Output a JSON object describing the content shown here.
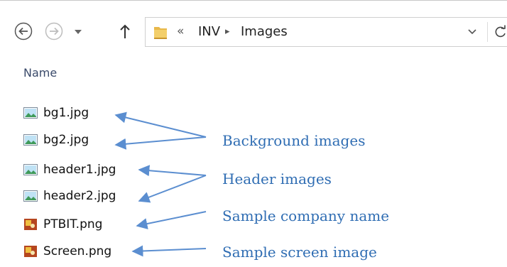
{
  "toolbar": {
    "back_icon": "back-arrow-icon",
    "forward_icon": "forward-arrow-icon",
    "recent_icon": "chevron-down-icon",
    "up_icon": "up-arrow-icon",
    "address": {
      "overflow": "«",
      "crumbs": [
        "INV",
        "Images"
      ],
      "separator": "▸",
      "dropdown_icon": "chevron-down-icon",
      "refresh_icon": "refresh-icon"
    }
  },
  "column_header": "Name",
  "files": [
    {
      "name": "bg1.jpg",
      "icon": "image-file-icon"
    },
    {
      "name": "bg2.jpg",
      "icon": "image-file-icon"
    },
    {
      "name": "header1.jpg",
      "icon": "image-file-icon"
    },
    {
      "name": "header2.jpg",
      "icon": "image-file-icon"
    },
    {
      "name": "PTBIT.png",
      "icon": "png-file-icon"
    },
    {
      "name": "Screen.png",
      "icon": "png-file-icon"
    }
  ],
  "annotations": [
    {
      "text": "Background images"
    },
    {
      "text": "Header images"
    },
    {
      "text": "Sample company name"
    },
    {
      "text": "Sample screen image"
    }
  ],
  "colors": {
    "annotation": "#2f6db3",
    "arrow": "#5b8ed0",
    "folder": "#e8b84a"
  }
}
